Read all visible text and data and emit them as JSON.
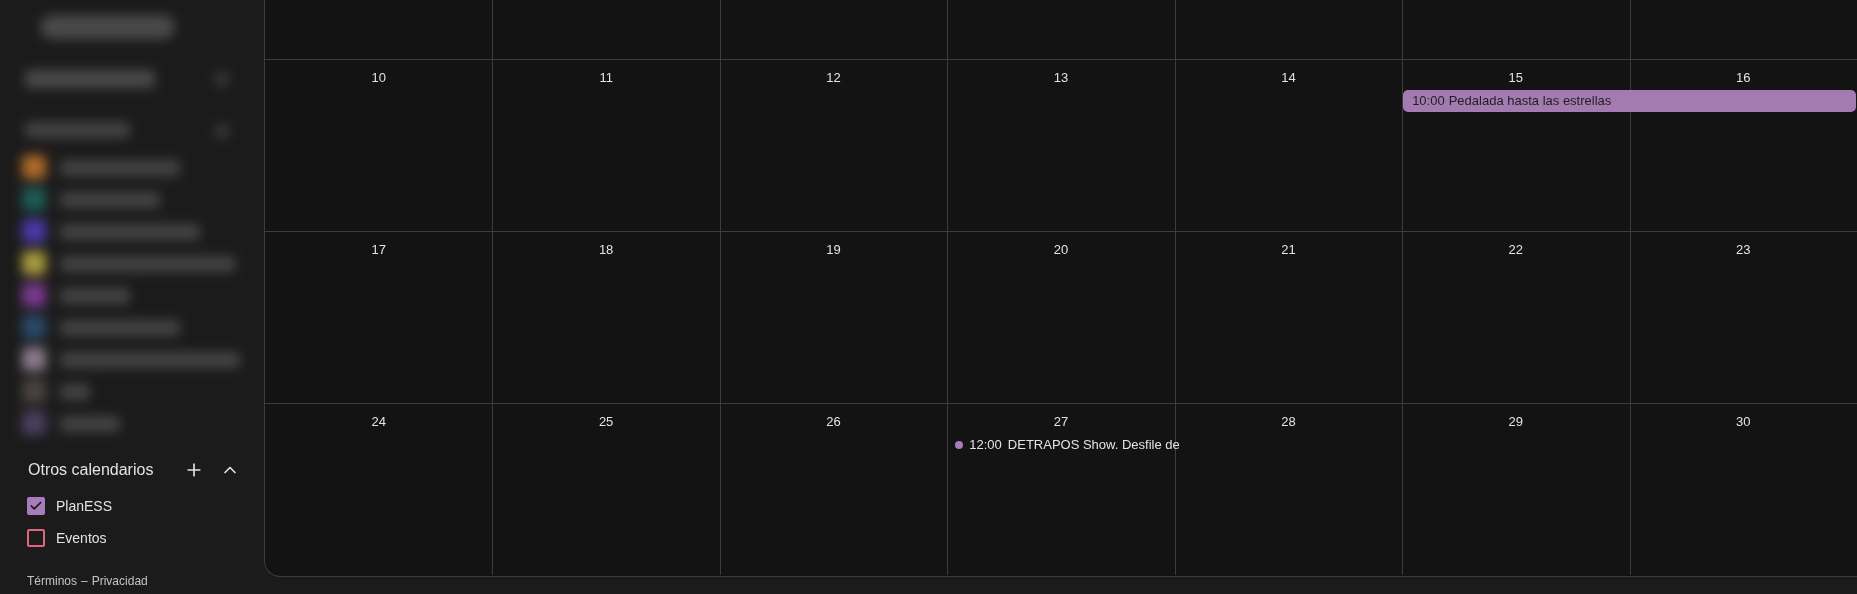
{
  "sidebar": {
    "other_calendars": {
      "title": "Otros calendarios",
      "expanded": true,
      "items": [
        {
          "label": "PlanESS",
          "checked": true,
          "color": "#a87cba"
        },
        {
          "label": "Eventos",
          "checked": false,
          "color": "#e0647f"
        }
      ]
    },
    "footer": {
      "terms": "Términos",
      "separator": "–",
      "privacy": "Privacidad"
    }
  },
  "calendar": {
    "weeks": [
      {
        "days": [
          {
            "date": "10"
          },
          {
            "date": "11"
          },
          {
            "date": "12"
          },
          {
            "date": "13"
          },
          {
            "date": "14"
          },
          {
            "date": "15",
            "events": [
              {
                "kind": "chip",
                "time": "10:00",
                "title": "Pedalada hasta las estrellas",
                "continues": true,
                "color": "#a37bb1"
              }
            ]
          },
          {
            "date": "16"
          }
        ]
      },
      {
        "days": [
          {
            "date": "17"
          },
          {
            "date": "18"
          },
          {
            "date": "19"
          },
          {
            "date": "20"
          },
          {
            "date": "21"
          },
          {
            "date": "22"
          },
          {
            "date": "23"
          }
        ]
      },
      {
        "days": [
          {
            "date": "24"
          },
          {
            "date": "25"
          },
          {
            "date": "26"
          },
          {
            "date": "27",
            "events": [
              {
                "kind": "dot",
                "time": "12:00",
                "title": "DETRAPOS Show. Desfile de",
                "color": "#a87cba"
              }
            ]
          },
          {
            "date": "28"
          },
          {
            "date": "29"
          },
          {
            "date": "30"
          }
        ]
      }
    ]
  }
}
